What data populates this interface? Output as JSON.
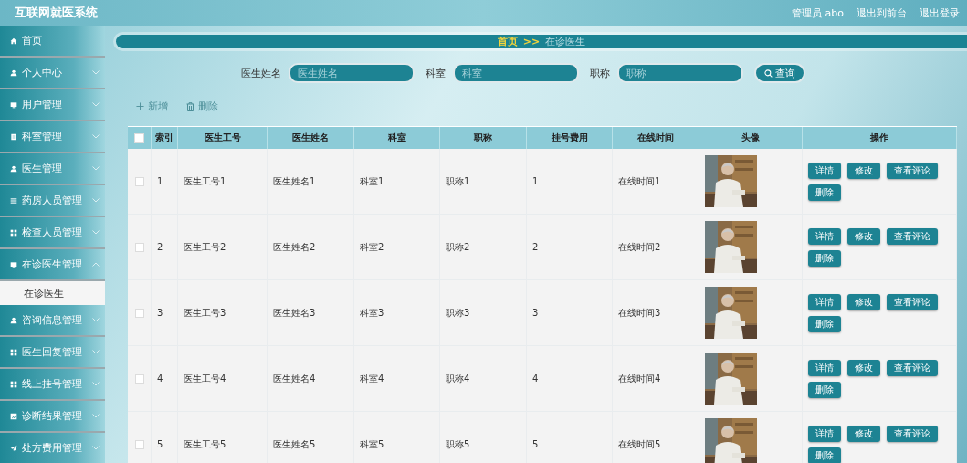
{
  "header": {
    "title": "互联网就医系统",
    "user": "管理员 abo",
    "links": [
      "退出到前台",
      "退出登录"
    ]
  },
  "sidebar": {
    "items": [
      {
        "label": "首页",
        "kind": "home",
        "has_children": false
      },
      {
        "label": "个人中心",
        "kind": "person",
        "has_children": true,
        "expanded": false
      },
      {
        "label": "用户管理",
        "kind": "monitor",
        "has_children": true,
        "expanded": false
      },
      {
        "label": "科室管理",
        "kind": "doc",
        "has_children": true,
        "expanded": false
      },
      {
        "label": "医生管理",
        "kind": "person",
        "has_children": true,
        "expanded": false
      },
      {
        "label": "药房人员管理",
        "kind": "list",
        "has_children": true,
        "expanded": false
      },
      {
        "label": "检查人员管理",
        "kind": "grid",
        "has_children": true,
        "expanded": false
      },
      {
        "label": "在诊医生管理",
        "kind": "monitor",
        "has_children": true,
        "expanded": true,
        "children": [
          {
            "label": "在诊医生",
            "selected": true
          }
        ]
      },
      {
        "label": "咨询信息管理",
        "kind": "person",
        "has_children": true,
        "expanded": false
      },
      {
        "label": "医生回复管理",
        "kind": "grid",
        "has_children": true,
        "expanded": false
      },
      {
        "label": "线上挂号管理",
        "kind": "grid",
        "has_children": true,
        "expanded": false
      },
      {
        "label": "诊断结果管理",
        "kind": "chart",
        "has_children": true,
        "expanded": false
      },
      {
        "label": "处方费用管理",
        "kind": "send",
        "has_children": true,
        "expanded": false
      }
    ]
  },
  "breadcrumb": {
    "home": "首页",
    "separator": ">>",
    "current": "在诊医生"
  },
  "search": {
    "fields": [
      {
        "label": "医生姓名",
        "placeholder": "医生姓名"
      },
      {
        "label": "科室",
        "placeholder": "科室"
      },
      {
        "label": "职称",
        "placeholder": "职称"
      }
    ],
    "button": "查询"
  },
  "toolbar": {
    "add": "新增",
    "delete": "删除"
  },
  "table": {
    "columns": [
      "索引",
      "医生工号",
      "医生姓名",
      "科室",
      "职称",
      "挂号费用",
      "在线时间",
      "头像",
      "操作"
    ],
    "header_checked": false,
    "rows": [
      {
        "checked": false,
        "cells": [
          "1",
          "医生工号1",
          "医生姓名1",
          "科室1",
          "职称1",
          "1",
          "在线时间1"
        ],
        "avatar": {
          "kind": "picture"
        },
        "actions": [
          "详情",
          "修改",
          "查看评论",
          "删除"
        ]
      },
      {
        "checked": false,
        "cells": [
          "2",
          "医生工号2",
          "医生姓名2",
          "科室2",
          "职称2",
          "2",
          "在线时间2"
        ],
        "avatar": {
          "kind": "picture"
        },
        "actions": [
          "详情",
          "修改",
          "查看评论",
          "删除"
        ]
      },
      {
        "checked": false,
        "cells": [
          "3",
          "医生工号3",
          "医生姓名3",
          "科室3",
          "职称3",
          "3",
          "在线时间3"
        ],
        "avatar": {
          "kind": "picture"
        },
        "actions": [
          "详情",
          "修改",
          "查看评论",
          "删除"
        ]
      },
      {
        "checked": false,
        "cells": [
          "4",
          "医生工号4",
          "医生姓名4",
          "科室4",
          "职称4",
          "4",
          "在线时间4"
        ],
        "avatar": {
          "kind": "picture"
        },
        "actions": [
          "详情",
          "修改",
          "查看评论",
          "删除"
        ]
      },
      {
        "checked": false,
        "cells": [
          "5",
          "医生工号5",
          "医生姓名5",
          "科室5",
          "职称5",
          "5",
          "在线时间5"
        ],
        "avatar": {
          "kind": "picture"
        },
        "actions": [
          "详情",
          "修改",
          "查看评论",
          "删除"
        ]
      }
    ]
  }
}
